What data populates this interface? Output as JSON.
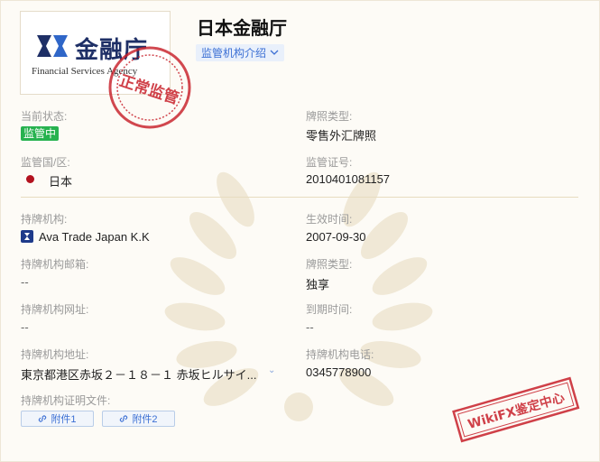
{
  "header": {
    "title": "日本金融厅",
    "intro_label": "监管机构介绍",
    "logo_text_jp": "金融庁",
    "logo_text_en": "Financial Services Agency",
    "stamp_top_text": "正常监管"
  },
  "fields": {
    "status_label": "当前状态:",
    "status_value": "监管中",
    "license_type_label": "牌照类型:",
    "license_type_value": "零售外汇牌照",
    "country_label": "监管国/区:",
    "country_value": "日本",
    "license_no_label": "监管证号:",
    "license_no_value": "2010401081157",
    "institution_label": "持牌机构:",
    "institution_value": "Ava Trade Japan K.K",
    "effective_label": "生效时间:",
    "effective_value": "2007-09-30",
    "email_label": "持牌机构邮箱:",
    "email_value": "--",
    "share_label": "牌照类型:",
    "share_value": "独享",
    "website_label": "持牌机构网址:",
    "website_value": "--",
    "expiry_label": "到期时间:",
    "expiry_value": "--",
    "address_label": "持牌机构地址:",
    "address_value": "東京都港区赤坂２－１８－１ 赤坂ヒルサイ...",
    "phone_label": "持牌机构电话:",
    "phone_value": "0345778900",
    "docs_label": "持牌机构证明文件:",
    "attachment1": "附件1",
    "attachment2": "附件2"
  },
  "stamp_bottom_text": "WikiFX鉴定中心",
  "colors": {
    "status_green": "#27b24f",
    "link_blue": "#3b6fd4",
    "stamp_red": "#c8202a",
    "brand_navy": "#1e2f66"
  }
}
